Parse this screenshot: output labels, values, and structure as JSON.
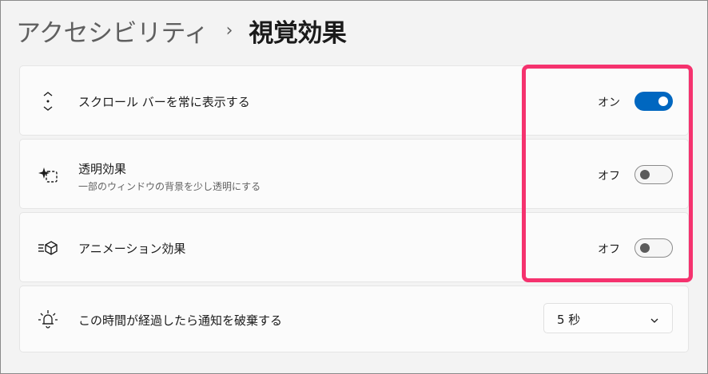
{
  "breadcrumb": {
    "parent": "アクセシビリティ",
    "separator": "›",
    "current": "視覚効果"
  },
  "settings": [
    {
      "icon": "scroll-arrows-icon",
      "title": "スクロール バーを常に表示する",
      "subtitle": "",
      "state": "オン",
      "toggle_on": true
    },
    {
      "icon": "transparency-sparkle-icon",
      "title": "透明効果",
      "subtitle": "一部のウィンドウの背景を少し透明にする",
      "state": "オフ",
      "toggle_on": false
    },
    {
      "icon": "animation-cube-icon",
      "title": "アニメーション効果",
      "subtitle": "",
      "state": "オフ",
      "toggle_on": false
    }
  ],
  "notification": {
    "icon": "notification-bell-icon",
    "title": "この時間が経過したら通知を破棄する",
    "selected_value": "5 秒"
  },
  "colors": {
    "accent": "#0067c0",
    "highlight": "#f5326e"
  }
}
